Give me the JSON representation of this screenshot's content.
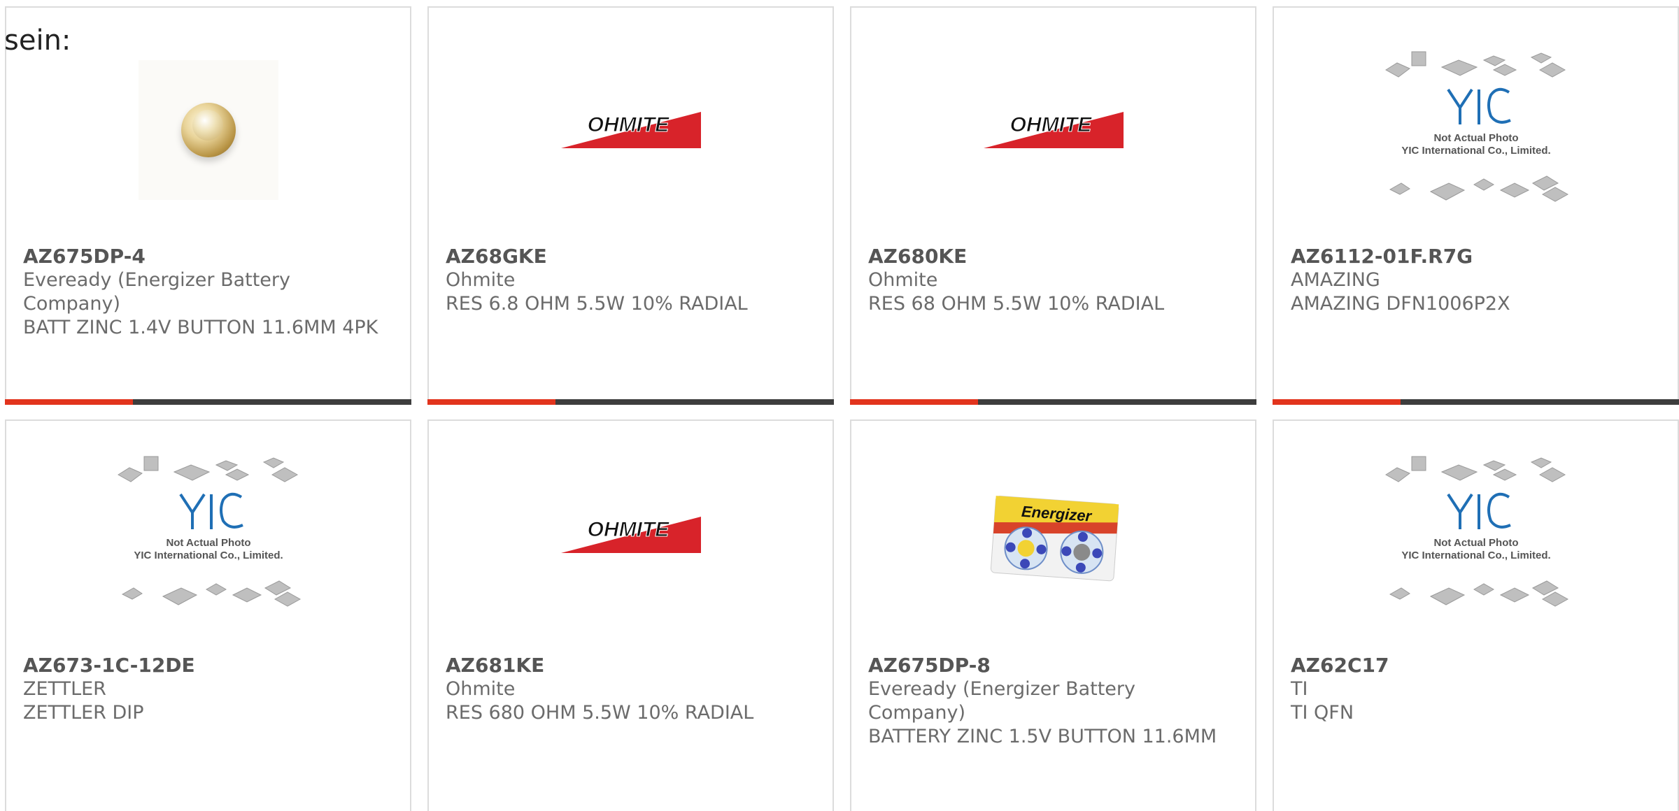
{
  "page_label": "sein:",
  "products": [
    {
      "part_number": "AZ675DP-4",
      "manufacturer": "Eveready (Energizer Battery Company)",
      "description": "BATT ZINC 1.4V BUTTON 11.6MM 4PK",
      "image": "battery-button"
    },
    {
      "part_number": "AZ68GKE",
      "manufacturer": "Ohmite",
      "description": "RES 6.8 OHM 5.5W 10% RADIAL",
      "image": "ohmite-logo"
    },
    {
      "part_number": "AZ680KE",
      "manufacturer": "Ohmite",
      "description": "RES 68 OHM 5.5W 10% RADIAL",
      "image": "ohmite-logo"
    },
    {
      "part_number": "AZ6112-01F.R7G",
      "manufacturer": "AMAZING",
      "description": "AMAZING DFN1006P2X",
      "image": "yic-placeholder"
    },
    {
      "part_number": "AZ673-1C-12DE",
      "manufacturer": "ZETTLER",
      "description": "ZETTLER DIP",
      "image": "yic-placeholder"
    },
    {
      "part_number": "AZ681KE",
      "manufacturer": "Ohmite",
      "description": "RES 680 OHM 5.5W 10% RADIAL",
      "image": "ohmite-logo"
    },
    {
      "part_number": "AZ675DP-8",
      "manufacturer": "Eveready (Energizer Battery Company)",
      "description": "BATTERY ZINC 1.5V BUTTON 11.6MM",
      "image": "energizer-pack"
    },
    {
      "part_number": "AZ62C17",
      "manufacturer": "TI",
      "description": "TI QFN",
      "image": "yic-placeholder"
    }
  ],
  "logos": {
    "ohmite": "OHMITE",
    "energizer": "Energizer",
    "yic_caption_1": "Not Actual Photo",
    "yic_caption_2": "YIC International Co., Limited."
  },
  "colors": {
    "accent": "#e2341d",
    "bar": "#3d3d3d",
    "ohmite_red": "#d8232a"
  }
}
